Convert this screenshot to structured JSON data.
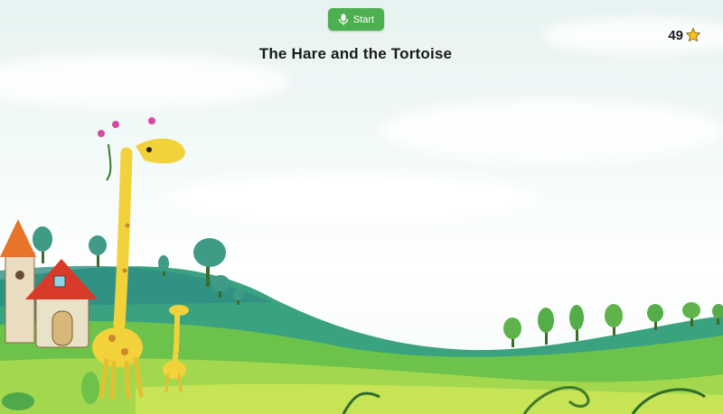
{
  "header": {
    "start_label": "Start",
    "story_title": "The Hare and the Tortoise"
  },
  "score": {
    "value": "49",
    "icon": "star-icon",
    "star_color": "#f6c21c"
  },
  "colors": {
    "button": "#4caf50",
    "grass": "#6cc24a",
    "hill": "#3aa27f",
    "giraffe": "#f2d23a"
  }
}
